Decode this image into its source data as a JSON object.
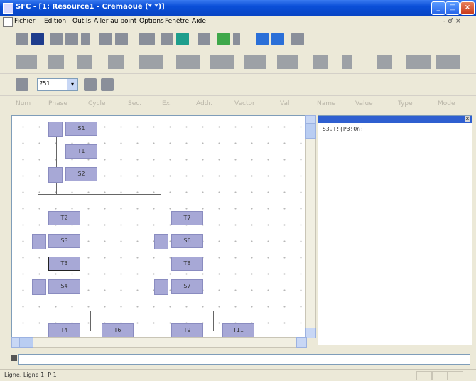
{
  "window": {
    "title": "SFC - [1: Resource1 - Cremaoue (* *)]"
  },
  "menu": {
    "items": [
      "Fichier",
      "Edition",
      "Outils",
      "Aller au point",
      "Options",
      "Fenêtre",
      "Aide"
    ],
    "mdi_controls": "- ♂ ×"
  },
  "toolbar3": {
    "combo_value": "?51"
  },
  "columns": [
    "Num",
    "Phase",
    "Cycle",
    "Sec.",
    "Ex.",
    "Addr.",
    "Vector",
    "Val",
    "Name",
    "Value",
    "Type",
    "Mode"
  ],
  "sfc": {
    "steps": {
      "s1": "S1",
      "t1": "T1",
      "s2": "S2",
      "t2": "T2",
      "s3": "S3",
      "t3": "T3",
      "s4": "S4",
      "t7": "T7",
      "s6": "S6",
      "t8": "T8",
      "s7": "S7",
      "t4": "T4",
      "t6": "T6",
      "t9": "T9",
      "t11": "T11"
    }
  },
  "panel": {
    "text": "S3.T!(P3!On:"
  },
  "status": {
    "text": "Ligne, Ligne 1, P 1"
  }
}
